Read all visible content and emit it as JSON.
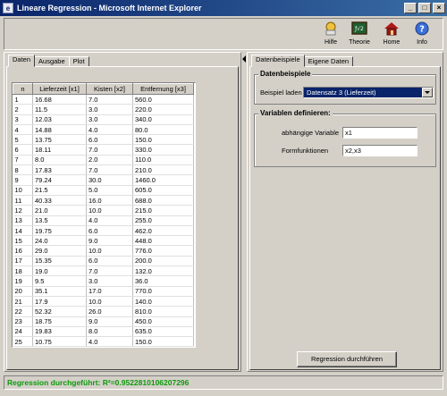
{
  "window": {
    "title": "Lineare Regression - Microsoft Internet Explorer"
  },
  "toolbar": {
    "items": [
      {
        "label": "Hilfe",
        "icon": "help-hand-icon"
      },
      {
        "label": "Theorie",
        "icon": "chalkboard-icon"
      },
      {
        "label": "Home",
        "icon": "home-icon"
      },
      {
        "label": "Info",
        "icon": "question-icon"
      }
    ]
  },
  "left_tabs": [
    "Daten",
    "Ausgabe",
    "Plot"
  ],
  "table": {
    "columns": [
      "n",
      "Lieferzeit [x1]",
      "Kisten [x2]",
      "Entfernung [x3]"
    ],
    "rows": [
      [
        "1",
        "16.68",
        "7.0",
        "560.0"
      ],
      [
        "2",
        "11.5",
        "3.0",
        "220.0"
      ],
      [
        "3",
        "12.03",
        "3.0",
        "340.0"
      ],
      [
        "4",
        "14.88",
        "4.0",
        "80.0"
      ],
      [
        "5",
        "13.75",
        "6.0",
        "150.0"
      ],
      [
        "6",
        "18.11",
        "7.0",
        "330.0"
      ],
      [
        "7",
        "8.0",
        "2.0",
        "110.0"
      ],
      [
        "8",
        "17.83",
        "7.0",
        "210.0"
      ],
      [
        "9",
        "79.24",
        "30.0",
        "1460.0"
      ],
      [
        "10",
        "21.5",
        "5.0",
        "605.0"
      ],
      [
        "11",
        "40.33",
        "16.0",
        "688.0"
      ],
      [
        "12",
        "21.0",
        "10.0",
        "215.0"
      ],
      [
        "13",
        "13.5",
        "4.0",
        "255.0"
      ],
      [
        "14",
        "19.75",
        "6.0",
        "462.0"
      ],
      [
        "15",
        "24.0",
        "9.0",
        "448.0"
      ],
      [
        "16",
        "29.0",
        "10.0",
        "776.0"
      ],
      [
        "17",
        "15.35",
        "6.0",
        "200.0"
      ],
      [
        "18",
        "19.0",
        "7.0",
        "132.0"
      ],
      [
        "19",
        "9.5",
        "3.0",
        "36.0"
      ],
      [
        "20",
        "35.1",
        "17.0",
        "770.0"
      ],
      [
        "21",
        "17.9",
        "10.0",
        "140.0"
      ],
      [
        "22",
        "52.32",
        "26.0",
        "810.0"
      ],
      [
        "23",
        "18.75",
        "9.0",
        "450.0"
      ],
      [
        "24",
        "19.83",
        "8.0",
        "635.0"
      ],
      [
        "25",
        "10.75",
        "4.0",
        "150.0"
      ]
    ]
  },
  "right_tabs": [
    "Datenbeispiele",
    "Eigene Daten"
  ],
  "datenbeispiele": {
    "group_title": "Datenbeispiele",
    "label": "Beispiel laden",
    "selected": "Datensatz 3 (Lieferzeit)"
  },
  "variablen": {
    "group_title": "Variablen definieren:",
    "dep_label": "abhängige Variable",
    "dep_value": "x1",
    "form_label": "Formfunktionen",
    "form_value": "x2,x3"
  },
  "run_button": "Regression durchführen",
  "status": "Regression durchgeführt: R²=0.9522810106207296",
  "colors": {
    "status": "#0c9a0c",
    "title_bar": "#0a246a",
    "selection": "#0a246a"
  }
}
